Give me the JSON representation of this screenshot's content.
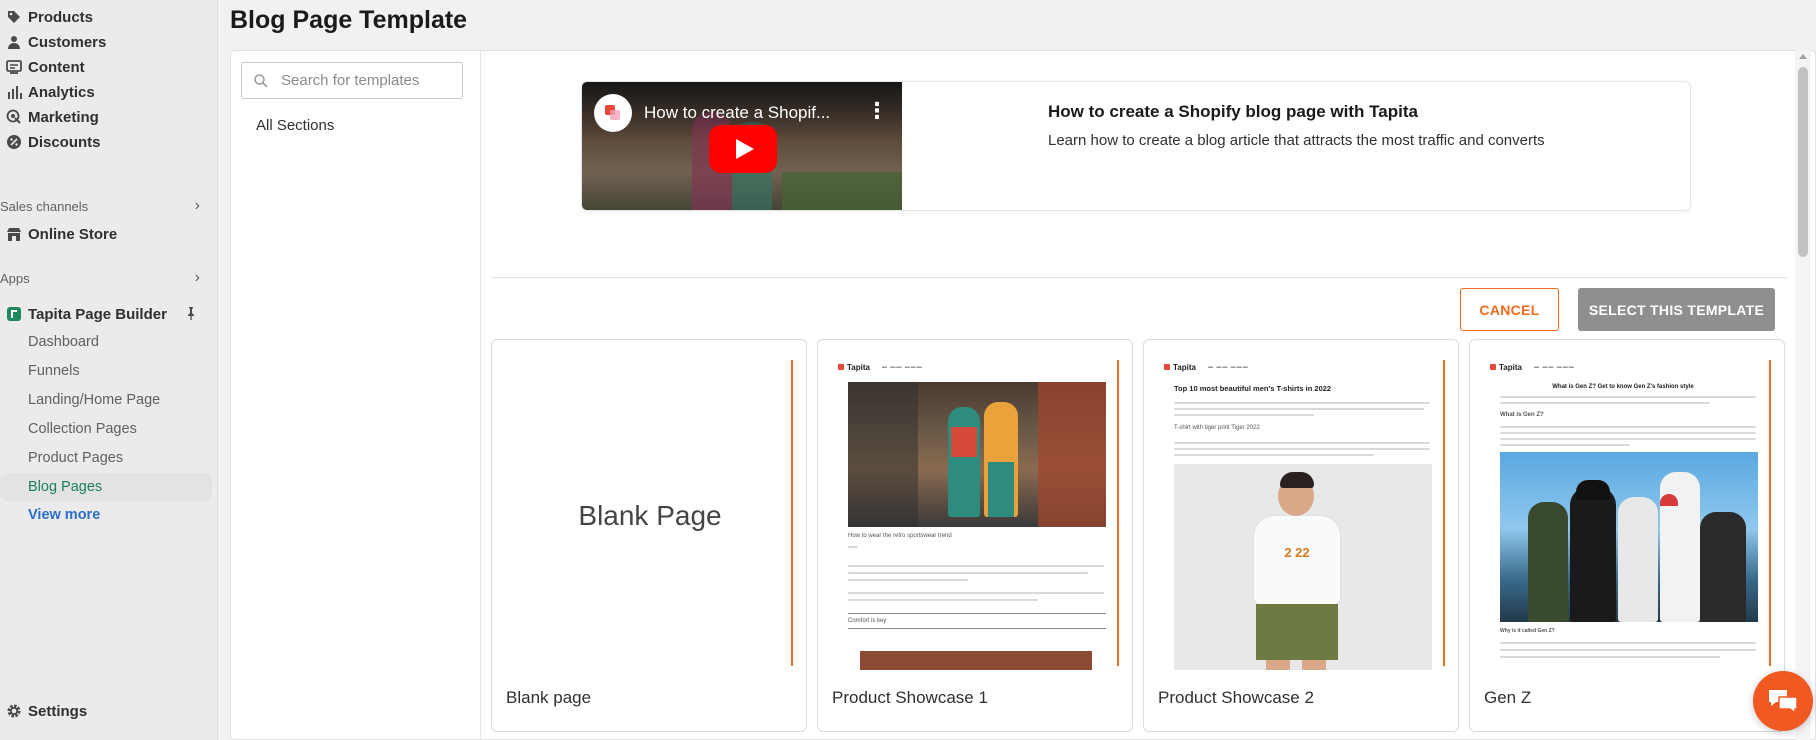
{
  "sidebar": {
    "nav": [
      {
        "label": "Products",
        "icon": "tag-icon"
      },
      {
        "label": "Customers",
        "icon": "person-icon"
      },
      {
        "label": "Content",
        "icon": "content-icon"
      },
      {
        "label": "Analytics",
        "icon": "bar-chart-icon"
      },
      {
        "label": "Marketing",
        "icon": "target-icon"
      },
      {
        "label": "Discounts",
        "icon": "discount-icon"
      }
    ],
    "sales_channels_label": "Sales channels",
    "online_store_label": "Online Store",
    "apps_label": "Apps",
    "app_name": "Tapita Page Builder",
    "app_items": [
      "Dashboard",
      "Funnels",
      "Landing/Home Page",
      "Collection Pages",
      "Product Pages",
      "Blog Pages"
    ],
    "view_more": "View more",
    "settings": "Settings"
  },
  "page_title": "Blog Page Template",
  "search": {
    "placeholder": "Search for templates"
  },
  "all_sections": "All Sections",
  "video": {
    "yt_title": "How to create a Shopif...",
    "heading": "How to create a Shopify blog page with Tapita",
    "description": "Learn how to create a blog article that attracts the most traffic and converts"
  },
  "buttons": {
    "cancel": "CANCEL",
    "select": "SELECT THIS TEMPLATE"
  },
  "templates": [
    {
      "name": "Blank page",
      "preview_text": "Blank Page"
    },
    {
      "name": "Product Showcase 1",
      "logo": "Tapita",
      "caption": "How to wear the retro sportswear trend",
      "subhead": "Comfort is key"
    },
    {
      "name": "Product Showcase 2",
      "logo": "Tapita",
      "heading": "Top 10 most beautiful men's T-shirts in 2022",
      "subhead": "T-shirt with tiger print Tiger 2022"
    },
    {
      "name": "Gen Z",
      "logo": "Tapita",
      "heading": "What is Gen Z? Get to know Gen Z's fashion style",
      "subhead": "What is Gen Z?",
      "subhead2": "Why is it called Gen Z?"
    }
  ],
  "colors": {
    "accent": "#f06a1f",
    "active_green": "#1a7f5a",
    "link_blue": "#2c6ecb",
    "disabled_gray": "#8f8f8f"
  }
}
